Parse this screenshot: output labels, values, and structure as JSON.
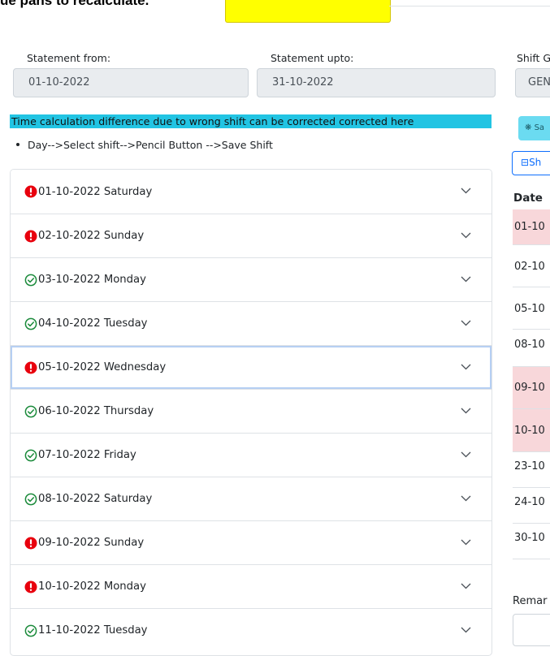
{
  "header": {
    "cut_text": "ue pans to recalculate."
  },
  "form": {
    "from_label": "Statement from:",
    "from_value": "01-10-2022",
    "upto_label": "Statement upto:",
    "upto_value": "31-10-2022",
    "shift_label": "Shift G",
    "shift_value": "GEN"
  },
  "note": {
    "highlight_text": "Time calculation difference due to wrong shift can be corrected corrected here",
    "bullet_text": "Day-->Select shift-->Pencil Button -->Save Shift"
  },
  "accordion": {
    "items": [
      {
        "label": "01-10-2022 Saturday",
        "status": "error"
      },
      {
        "label": "02-10-2022 Sunday",
        "status": "error"
      },
      {
        "label": "03-10-2022 Monday",
        "status": "ok"
      },
      {
        "label": "04-10-2022 Tuesday",
        "status": "ok"
      },
      {
        "label": "05-10-2022 Wednesday",
        "status": "error"
      },
      {
        "label": "06-10-2022 Thursday",
        "status": "ok"
      },
      {
        "label": "07-10-2022 Friday",
        "status": "ok"
      },
      {
        "label": "08-10-2022 Saturday",
        "status": "ok"
      },
      {
        "label": "09-10-2022 Sunday",
        "status": "error"
      },
      {
        "label": "10-10-2022 Monday",
        "status": "error"
      },
      {
        "label": "11-10-2022 Tuesday",
        "status": "ok"
      }
    ]
  },
  "side_panel": {
    "info_button_label": "Sa",
    "outline_button_label": "Sh",
    "table_header": "Date",
    "rows": [
      {
        "date": "01-10",
        "highlight": true
      },
      {
        "date": "02-10",
        "highlight": false
      },
      {
        "date": "05-10",
        "highlight": false
      },
      {
        "date": "08-10",
        "highlight": false
      },
      {
        "date": "09-10",
        "highlight": true
      },
      {
        "date": "10-10",
        "highlight": true
      },
      {
        "date": "23-10",
        "highlight": false
      },
      {
        "date": "24-10",
        "highlight": false
      },
      {
        "date": "30-10",
        "highlight": false
      }
    ],
    "remark_label": "Remar"
  },
  "colors": {
    "error": "#e8000d",
    "ok": "#1a8a3a",
    "info": "#22c4e3",
    "highlight_row": "#f8d7da",
    "yellow": "#ffff00"
  }
}
